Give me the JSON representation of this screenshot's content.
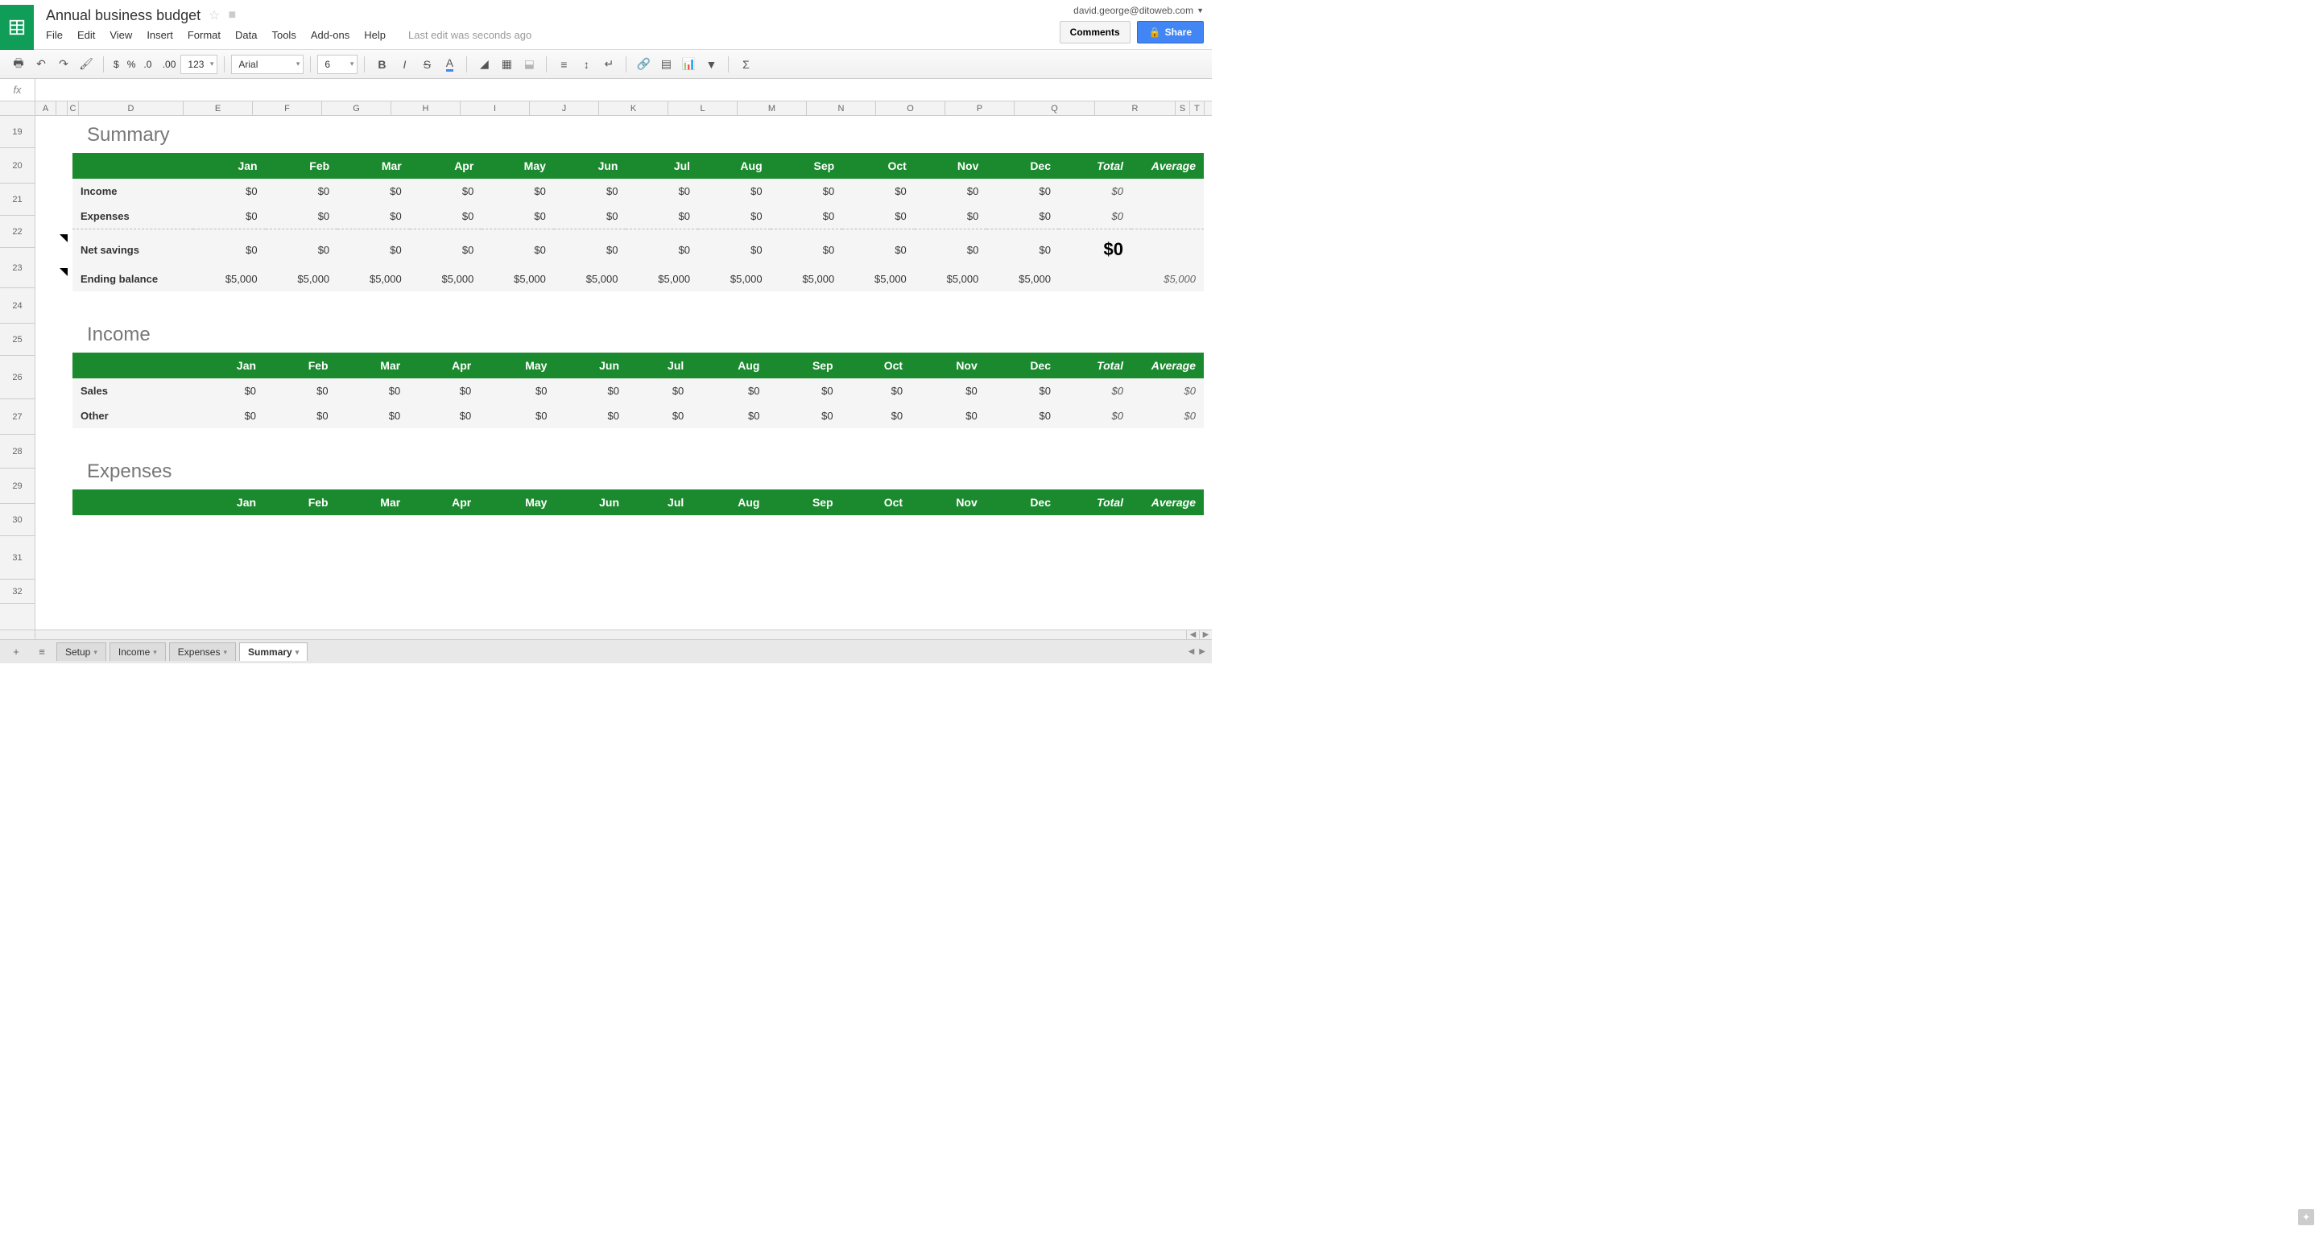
{
  "header": {
    "title": "Annual business budget",
    "user_email": "david.george@ditoweb.com",
    "last_edit": "Last edit was seconds ago",
    "comments_btn": "Comments",
    "share_btn": "Share"
  },
  "menu": [
    "File",
    "Edit",
    "View",
    "Insert",
    "Format",
    "Data",
    "Tools",
    "Add-ons",
    "Help"
  ],
  "toolbar": {
    "font_name": "Arial",
    "font_size": "6",
    "num_fmt": "123"
  },
  "columns": [
    {
      "l": "A",
      "w": 26
    },
    {
      "l": "",
      "w": 14
    },
    {
      "l": "C",
      "w": 14
    },
    {
      "l": "D",
      "w": 130
    },
    {
      "l": "E",
      "w": 86
    },
    {
      "l": "F",
      "w": 86
    },
    {
      "l": "G",
      "w": 86
    },
    {
      "l": "H",
      "w": 86
    },
    {
      "l": "I",
      "w": 86
    },
    {
      "l": "J",
      "w": 86
    },
    {
      "l": "K",
      "w": 86
    },
    {
      "l": "L",
      "w": 86
    },
    {
      "l": "M",
      "w": 86
    },
    {
      "l": "N",
      "w": 86
    },
    {
      "l": "O",
      "w": 86
    },
    {
      "l": "P",
      "w": 86
    },
    {
      "l": "Q",
      "w": 100
    },
    {
      "l": "R",
      "w": 100
    },
    {
      "l": "S",
      "w": 18
    },
    {
      "l": "T",
      "w": 18
    }
  ],
  "rows": [
    {
      "n": "19",
      "h": 40
    },
    {
      "n": "20",
      "h": 44
    },
    {
      "n": "21",
      "h": 40
    },
    {
      "n": "22",
      "h": 40
    },
    {
      "n": "23",
      "h": 50
    },
    {
      "n": "24",
      "h": 44
    },
    {
      "n": "25",
      "h": 40
    },
    {
      "n": "26",
      "h": 54
    },
    {
      "n": "27",
      "h": 44
    },
    {
      "n": "28",
      "h": 42
    },
    {
      "n": "29",
      "h": 44
    },
    {
      "n": "30",
      "h": 40
    },
    {
      "n": "31",
      "h": 54
    },
    {
      "n": "32",
      "h": 30
    }
  ],
  "months": [
    "Jan",
    "Feb",
    "Mar",
    "Apr",
    "May",
    "Jun",
    "Jul",
    "Aug",
    "Sep",
    "Oct",
    "Nov",
    "Dec"
  ],
  "head_total": "Total",
  "head_avg": "Average",
  "sections": {
    "summary": {
      "title": "Summary",
      "rows": [
        {
          "label": "Income",
          "vals": [
            "$0",
            "$0",
            "$0",
            "$0",
            "$0",
            "$0",
            "$0",
            "$0",
            "$0",
            "$0",
            "$0",
            "$0"
          ],
          "total": "$0",
          "avg": ""
        },
        {
          "label": "Expenses",
          "vals": [
            "$0",
            "$0",
            "$0",
            "$0",
            "$0",
            "$0",
            "$0",
            "$0",
            "$0",
            "$0",
            "$0",
            "$0"
          ],
          "total": "$0",
          "avg": ""
        }
      ],
      "net": {
        "label": "Net savings",
        "vals": [
          "$0",
          "$0",
          "$0",
          "$0",
          "$0",
          "$0",
          "$0",
          "$0",
          "$0",
          "$0",
          "$0",
          "$0"
        ],
        "total": "$0",
        "avg": ""
      },
      "ending": {
        "label": "Ending balance",
        "vals": [
          "$5,000",
          "$5,000",
          "$5,000",
          "$5,000",
          "$5,000",
          "$5,000",
          "$5,000",
          "$5,000",
          "$5,000",
          "$5,000",
          "$5,000",
          "$5,000"
        ],
        "total": "",
        "avg": "$5,000"
      }
    },
    "income": {
      "title": "Income",
      "rows": [
        {
          "label": "Sales",
          "vals": [
            "$0",
            "$0",
            "$0",
            "$0",
            "$0",
            "$0",
            "$0",
            "$0",
            "$0",
            "$0",
            "$0",
            "$0"
          ],
          "total": "$0",
          "avg": "$0"
        },
        {
          "label": "Other",
          "vals": [
            "$0",
            "$0",
            "$0",
            "$0",
            "$0",
            "$0",
            "$0",
            "$0",
            "$0",
            "$0",
            "$0",
            "$0"
          ],
          "total": "$0",
          "avg": "$0"
        }
      ]
    },
    "expenses": {
      "title": "Expenses"
    }
  },
  "sheets": [
    {
      "name": "Setup",
      "active": false
    },
    {
      "name": "Income",
      "active": false
    },
    {
      "name": "Expenses",
      "active": false
    },
    {
      "name": "Summary",
      "active": true
    }
  ]
}
